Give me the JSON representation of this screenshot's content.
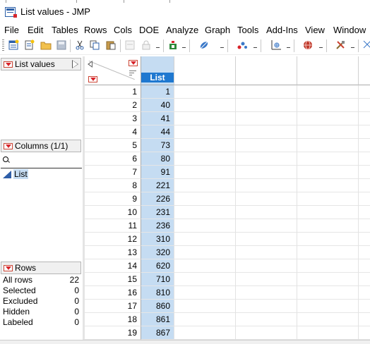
{
  "window": {
    "title": "List values - JMP"
  },
  "menu": [
    "File",
    "Edit",
    "Tables",
    "Rows",
    "Cols",
    "DOE",
    "Analyze",
    "Graph",
    "Tools",
    "Add-Ins",
    "View",
    "Window"
  ],
  "toolbar": {
    "buttons": [
      "new-data-table-icon",
      "new-script-icon",
      "open-folder-icon",
      "save-icon",
      "cut-icon",
      "copy-icon",
      "paste-icon",
      "disabled-table-icon",
      "lock-icon",
      "add-in-icon",
      "link-icon",
      "graph-builder-icon",
      "scatter-icon",
      "globe-icon",
      "tools-icon"
    ]
  },
  "left_panel": {
    "table_title": "List values",
    "columns_title": "Columns (1/1)",
    "column_name": "List",
    "rows_title": "Rows",
    "row_states": [
      {
        "label": "All rows",
        "value": "22"
      },
      {
        "label": "Selected",
        "value": "0"
      },
      {
        "label": "Excluded",
        "value": "0"
      },
      {
        "label": "Hidden",
        "value": "0"
      },
      {
        "label": "Labeled",
        "value": "0"
      }
    ]
  },
  "grid": {
    "column_header": "List",
    "rows": [
      {
        "n": "1",
        "v": "1"
      },
      {
        "n": "2",
        "v": "40"
      },
      {
        "n": "3",
        "v": "41"
      },
      {
        "n": "4",
        "v": "44"
      },
      {
        "n": "5",
        "v": "73"
      },
      {
        "n": "6",
        "v": "80"
      },
      {
        "n": "7",
        "v": "91"
      },
      {
        "n": "8",
        "v": "221"
      },
      {
        "n": "9",
        "v": "226"
      },
      {
        "n": "10",
        "v": "231"
      },
      {
        "n": "11",
        "v": "236"
      },
      {
        "n": "12",
        "v": "310"
      },
      {
        "n": "13",
        "v": "320"
      },
      {
        "n": "14",
        "v": "620"
      },
      {
        "n": "15",
        "v": "710"
      },
      {
        "n": "16",
        "v": "810"
      },
      {
        "n": "17",
        "v": "860"
      },
      {
        "n": "18",
        "v": "861"
      },
      {
        "n": "19",
        "v": "867"
      }
    ]
  },
  "colors": {
    "selected_column": "#c5dcf2",
    "header_blue": "#1f78d0",
    "red_triangle": "#d8232a"
  }
}
